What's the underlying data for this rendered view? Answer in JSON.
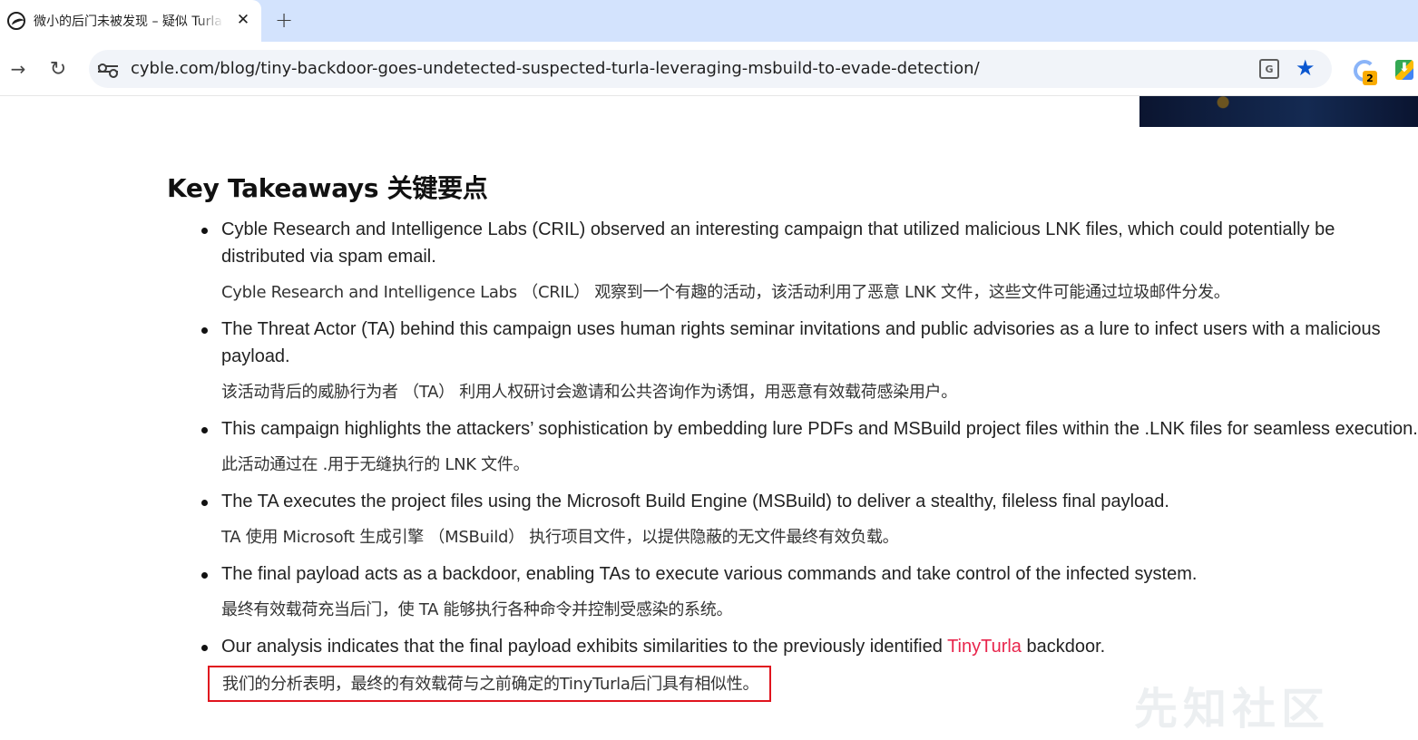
{
  "browser": {
    "tab": {
      "title": "微小的后门未被发现 – 疑似 Turla",
      "close_glyph": "✕"
    },
    "new_tab_glyph": "+",
    "forward_glyph": "→",
    "reload_glyph": "↻",
    "url": "cyble.com/blog/tiny-backdoor-goes-undetected-suspected-turla-leveraging-msbuild-to-evade-detection/",
    "extension_badge": "2",
    "icons": [
      "favicon-icon",
      "close-icon",
      "plus-icon",
      "forward-icon",
      "reload-icon",
      "site-info-icon",
      "translate-icon",
      "star-icon",
      "extension-icon",
      "download-icon"
    ]
  },
  "article": {
    "heading": "Key Takeaways 关键要点",
    "items": [
      {
        "en": "Cyble Research and Intelligence Labs (CRIL) observed an interesting campaign that utilized malicious LNK files, which could potentially be distributed via spam email.",
        "zh": "Cyble Research and Intelligence Labs （CRIL） 观察到一个有趣的活动，该活动利用了恶意 LNK 文件，这些文件可能通过垃圾邮件分发。"
      },
      {
        "en": "The Threat Actor (TA) behind this campaign uses human rights seminar invitations and public advisories as a lure to infect users with a malicious payload.",
        "zh": "该活动背后的威胁行为者 （TA） 利用人权研讨会邀请和公共咨询作为诱饵，用恶意有效载荷感染用户。"
      },
      {
        "en": "This campaign highlights the attackers’ sophistication by embedding lure PDFs and MSBuild project files within the .LNK files for seamless execution.",
        "zh": "此活动通过在 .用于无缝执行的 LNK 文件。"
      },
      {
        "en": "The TA executes the project files using the Microsoft Build Engine (MSBuild) to deliver a stealthy, fileless final payload.",
        "zh": "TA 使用 Microsoft 生成引擎 （MSBuild） 执行项目文件，以提供隐蔽的无文件最终有效负载。"
      },
      {
        "en": "The final payload acts as a backdoor, enabling TAs to execute various commands and take control of the infected system.",
        "zh": "最终有效载荷充当后门，使 TA 能够执行各种命令并控制受感染的系统。"
      },
      {
        "en_before": "Our analysis indicates that the final payload exhibits similarities to the previously identified ",
        "en_link": "TinyTurla",
        "en_after": " backdoor.",
        "zh": "我们的分析表明，最终的有效载荷与之前确定的TinyTurla后门具有相似性。"
      }
    ]
  },
  "watermark": "先知社区",
  "colors": {
    "link": "#e8254c",
    "highlight_box": "#e0141e",
    "tabstrip": "#d3e3fd",
    "omnibox": "#f1f4f9",
    "star": "#0b57d0"
  }
}
